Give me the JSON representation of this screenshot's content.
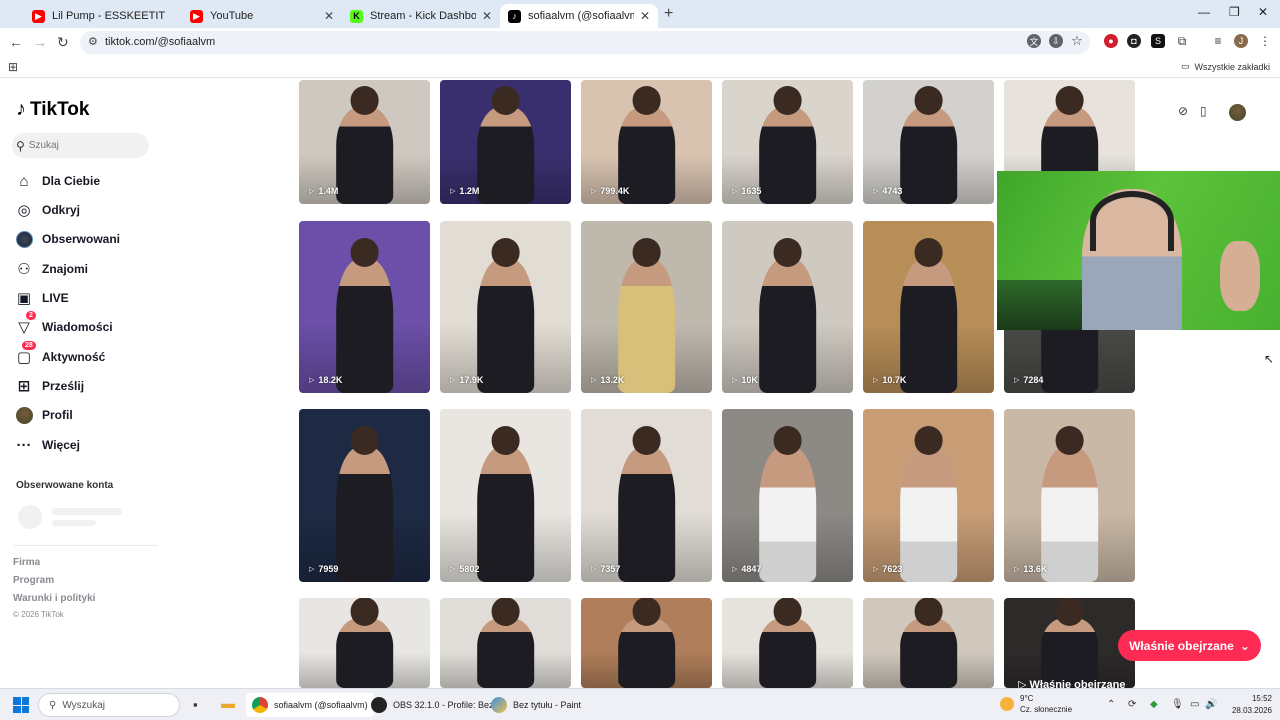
{
  "browser": {
    "tabs": [
      {
        "title": "Lil Pump - ESSKEETIT (Official M",
        "icon": "youtube-icon",
        "color": "#ff0000"
      },
      {
        "title": "YouTube",
        "icon": "youtube-icon",
        "color": "#ff0000"
      },
      {
        "title": "Stream - Kick Dashboard",
        "icon": "kick-icon",
        "color": "#53fc18"
      },
      {
        "title": "sofiaalvm (@sofiaalvm) | TikTok",
        "icon": "tiktok-icon",
        "color": "#000000"
      }
    ],
    "url": "tiktok.com/@sofiaalvm",
    "bookmarks_label": "Wszystkie zakładki"
  },
  "sidebar": {
    "logo": "TikTok",
    "search_placeholder": "Szukaj",
    "nav": [
      {
        "label": "Dla Ciebie",
        "icon": "home-icon",
        "glyph": "⌂"
      },
      {
        "label": "Odkryj",
        "icon": "compass-icon",
        "glyph": "◎"
      },
      {
        "label": "Obserwowani",
        "icon": "following-avatar-icon",
        "glyph": "●"
      },
      {
        "label": "Znajomi",
        "icon": "friends-icon",
        "glyph": "⚇"
      },
      {
        "label": "LIVE",
        "icon": "live-icon",
        "glyph": "▣"
      },
      {
        "label": "Wiadomości",
        "icon": "messages-icon",
        "glyph": "▽",
        "badge": "2"
      },
      {
        "label": "Aktywność",
        "icon": "activity-icon",
        "glyph": "▢",
        "badge": "28"
      },
      {
        "label": "Prześlij",
        "icon": "upload-icon",
        "glyph": "⊞"
      },
      {
        "label": "Profil",
        "icon": "profile-avatar-icon",
        "glyph": ""
      },
      {
        "label": "Więcej",
        "icon": "more-icon",
        "glyph": "···"
      }
    ],
    "followed_heading": "Obserwowane konta",
    "footer": [
      "Firma",
      "Program",
      "Warunki i polityki"
    ],
    "copyright": "© 2026 TikTok"
  },
  "grid": {
    "rows": [
      [
        "1.4M",
        "1.2M",
        "799.4K",
        "1635",
        "4743",
        ""
      ],
      [
        "18.2K",
        "17.9K",
        "13.2K",
        "10K",
        "10.7K",
        "7284"
      ],
      [
        "7959",
        "5802",
        "7357",
        "4847",
        "7623",
        "13.6K"
      ],
      [
        "",
        "",
        "",
        "",
        "",
        ""
      ]
    ],
    "colors": [
      [
        "#cfc8c0",
        "#3a2f6e",
        "#d8c3b0",
        "#d9d4cc",
        "#d3d1cd",
        "#e7e3dc"
      ],
      [
        "#6b4fa8",
        "#e2ddd4",
        "#bfb8ad",
        "#cfcac1",
        "#b88e58",
        "#4a4a48"
      ],
      [
        "#1e2a44",
        "#e9e6e1",
        "#e1ddd6",
        "#8d8a86",
        "#c89d76",
        "#c9b8a6"
      ],
      [
        "#e8e6e3",
        "#e0ddd8",
        "#b07e5a",
        "#e6e2dc",
        "#d0c8bd",
        "#2d2b2a"
      ]
    ]
  },
  "overlay": {
    "watched_button": "Właśnie obejrzane",
    "watched_tile": "Właśnie obejrzane"
  },
  "taskbar": {
    "search_placeholder": "Wyszukaj",
    "apps": [
      {
        "label": "sofiaalvm (@sofiaalvm)",
        "icon": "chrome-icon"
      },
      {
        "label": "OBS 32.1.0 - Profile: Bez",
        "icon": "obs-icon"
      },
      {
        "label": "Bez tytułu - Paint",
        "icon": "paint-icon"
      }
    ],
    "weather_temp": "9°C",
    "weather_desc": "Cz. słonecznie",
    "time": "15:52",
    "date": "28.03.2026"
  }
}
